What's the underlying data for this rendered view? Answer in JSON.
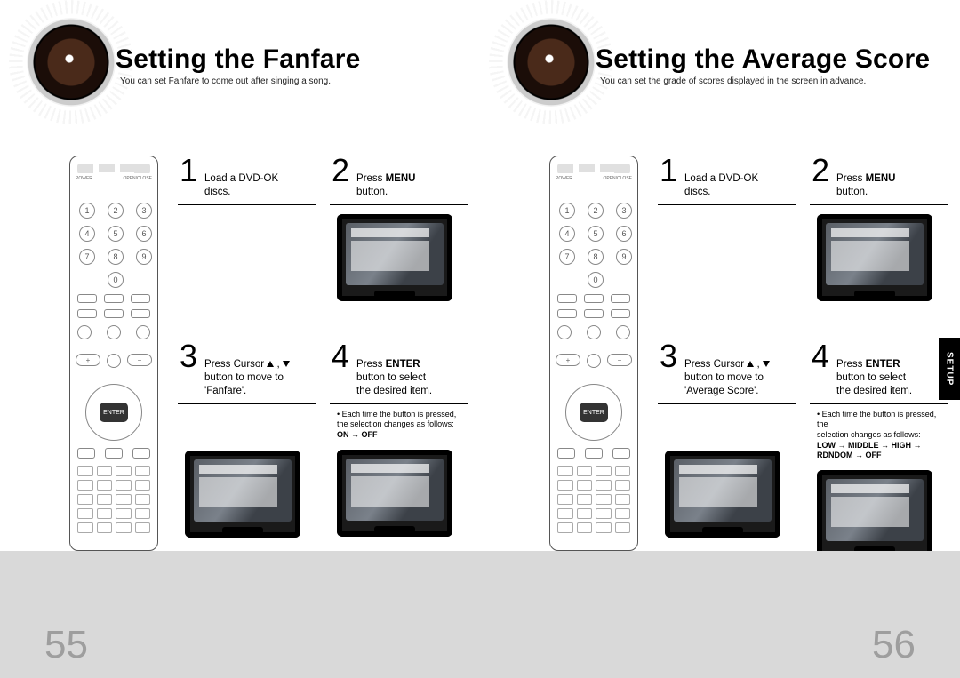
{
  "left": {
    "title": "Setting the Fanfare",
    "subtitle": "You can set Fanfare to come out after singing a song.",
    "steps": {
      "s1": {
        "num": "1",
        "text_a": "Load a DVD-OK",
        "text_b": "discs."
      },
      "s2": {
        "num": "2",
        "text_a": "Press ",
        "bold": "MENU",
        "text_b": "button."
      },
      "s3": {
        "num": "3",
        "text_a": "Press Cursor ",
        "text_b": "button to move to",
        "text_c": "'Fanfare'."
      },
      "s4": {
        "num": "4",
        "text_a": "Press ",
        "bold": "ENTER",
        "text_b": "button to select",
        "text_c": "the desired item."
      }
    },
    "note": {
      "line1": "Each time the button is pressed,",
      "line2": "the selection changes as follows:",
      "seq": "ON → OFF"
    },
    "page_number": "55"
  },
  "right": {
    "title": "Setting the Average Score",
    "subtitle": "You can set the grade of scores displayed in the screen in advance.",
    "steps": {
      "s1": {
        "num": "1",
        "text_a": "Load a DVD-OK",
        "text_b": "discs."
      },
      "s2": {
        "num": "2",
        "text_a": "Press ",
        "bold": "MENU",
        "text_b": "button."
      },
      "s3": {
        "num": "3",
        "text_a": "Press Cursor ",
        "text_b": "button to move to",
        "text_c": "'Average Score'."
      },
      "s4": {
        "num": "4",
        "text_a": "Press ",
        "bold": "ENTER",
        "text_b": "button to select",
        "text_c": "the desired item."
      }
    },
    "note": {
      "line1": "Each time the button is pressed, the",
      "line2": "selection changes as follows:",
      "seq": "LOW → MIDDLE → HIGH → RDNDOM → OFF"
    },
    "page_number": "56",
    "tab": "SETUP"
  },
  "remote_numbers": [
    "1",
    "2",
    "3",
    "4",
    "5",
    "6",
    "7",
    "8",
    "9",
    "0"
  ]
}
